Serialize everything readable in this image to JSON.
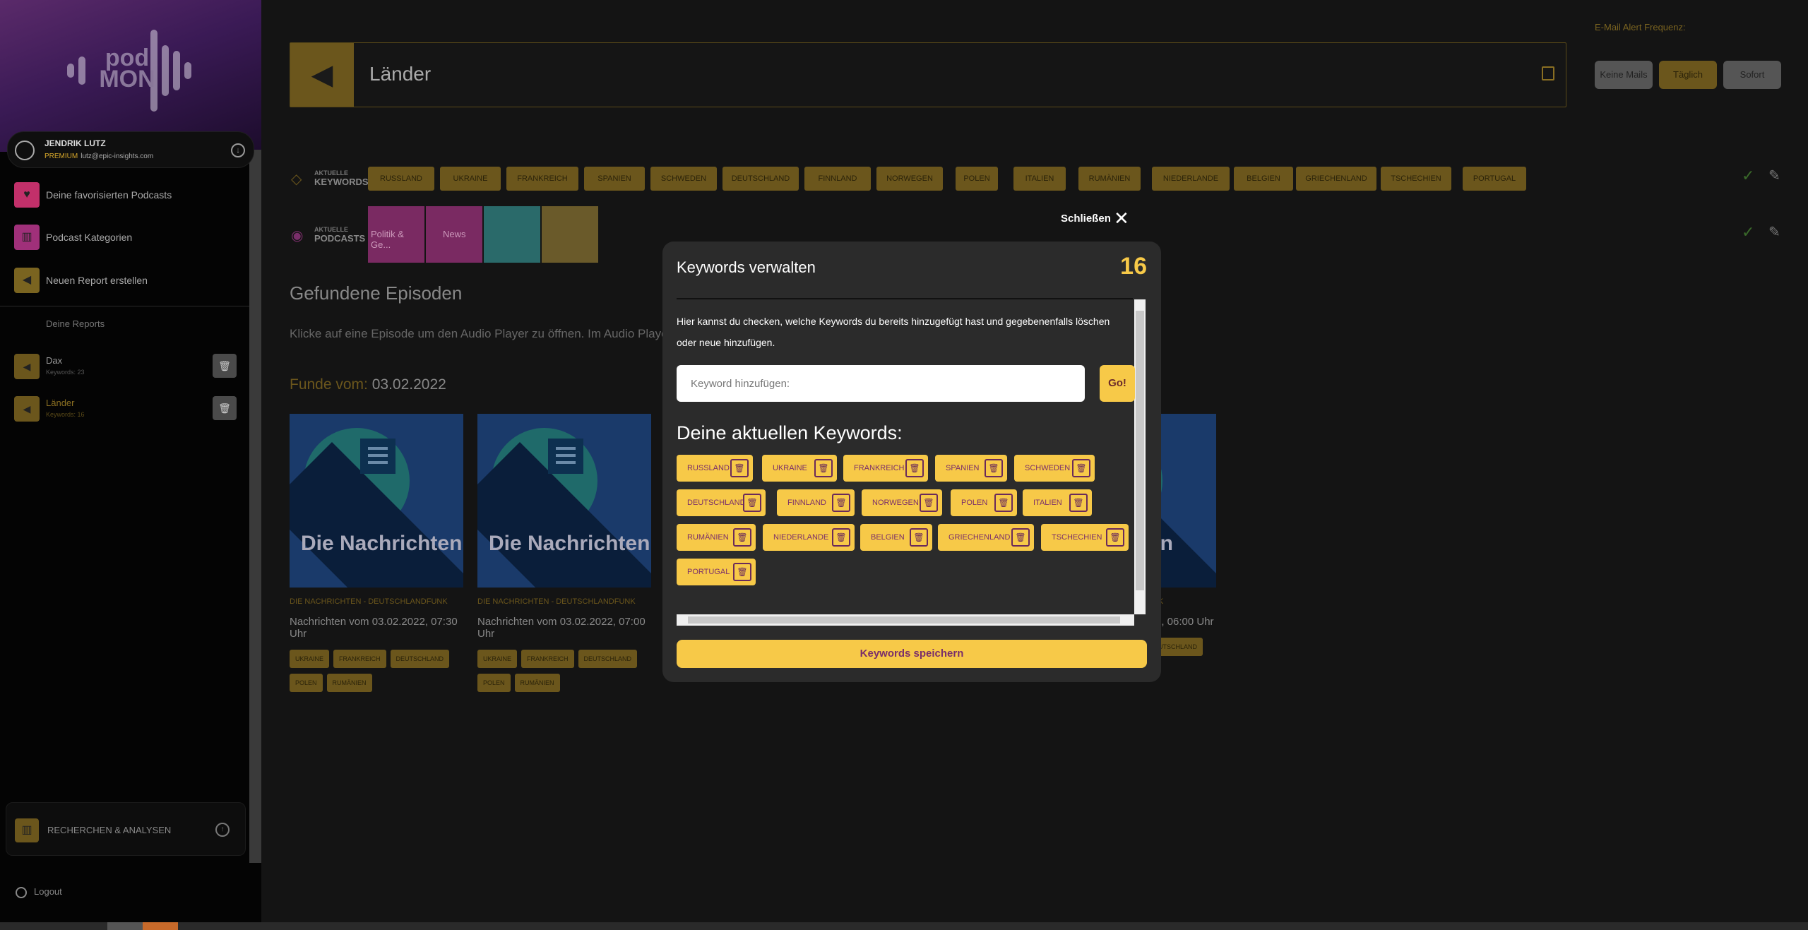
{
  "brand": {
    "logo_text_top": "pod",
    "logo_text_bottom": "MON"
  },
  "user": {
    "name": "JENDRIK LUTZ",
    "plan": "PREMIUM",
    "email": "lutz@epic-insights.com"
  },
  "sidebar": {
    "items": [
      {
        "label": "Deine favorisierten Podcasts",
        "icon": "heart-icon",
        "color": "#c2306a"
      },
      {
        "label": "Podcast Kategorien",
        "icon": "chart-icon",
        "color": "#a0307a"
      },
      {
        "label": "Neuen Report erstellen",
        "icon": "megaphone-icon",
        "color": "#7a6420"
      }
    ],
    "reports_title": "Deine Reports",
    "reports": [
      {
        "title": "Dax",
        "sub": "Keywords: 23"
      },
      {
        "title": "Länder",
        "sub": "Keywords: 16"
      }
    ],
    "research_label": "RECHERCHEN & ANALYSEN",
    "logout_label": "Logout"
  },
  "main": {
    "title": "Länder",
    "alert": {
      "label": "E-Mail Alert Frequenz:",
      "options": [
        "Keine Mails",
        "Täglich",
        "Sofort"
      ],
      "selected": "Täglich"
    },
    "keywords_label_small": "AKTUELLE",
    "keywords_label_big": "KEYWORDS",
    "podcasts_label_small": "AKTUELLE",
    "podcasts_label_big": "PODCASTS",
    "keywords": [
      "RUSSLAND",
      "UKRAINE",
      "FRANKREICH",
      "SPANIEN",
      "SCHWEDEN",
      "DEUTSCHLAND",
      "FINNLAND",
      "NORWEGEN",
      "POLEN",
      "ITALIEN",
      "RUMÄNIEN",
      "NIEDERLANDE",
      "BELGIEN",
      "GRIECHENLAND",
      "TSCHECHIEN",
      "PORTUGAL"
    ],
    "podcasts": [
      "Politik & Ge...",
      "News"
    ],
    "found_title": "Gefundene Episoden",
    "found_hint": "Klicke auf eine Episode um den Audio Player zu öffnen. Im Audio Player kannst du",
    "found_date_label": "Funde vom:",
    "found_date": "03.02.2022",
    "episodes": [
      {
        "image_text": "Die Nachrichten",
        "source": "DIE NACHRICHTEN - DEUTSCHLANDFUNK",
        "title": "Nachrichten vom 03.02.2022, 07:30 Uhr",
        "chips": [
          "UKRAINE",
          "FRANKREICH",
          "DEUTSCHLAND",
          "POLEN",
          "RUMÄNIEN"
        ]
      },
      {
        "image_text": "Die Nachrichten",
        "source": "DIE NACHRICHTEN - DEUTSCHLANDFUNK",
        "title": "Nachrichten vom 03.02.2022, 07:00 Uhr",
        "chips": [
          "UKRAINE",
          "FRANKREICH",
          "DEUTSCHLAND",
          "POLEN",
          "RUMÄNIEN"
        ]
      }
    ],
    "episode_partial": {
      "image_text": "en",
      "source": "UNK",
      "title": "2, 06:00 Uhr",
      "chip": "EUTSCHLAND"
    }
  },
  "modal": {
    "close_label": "Schließen",
    "title": "Keywords verwalten",
    "count": "16",
    "description": "Hier kannst du checken, welche Keywords du bereits hinzugefügt hast und gegebenenfalls löschen oder neue hinzufügen.",
    "input_placeholder": "Keyword hinzufügen:",
    "go_label": "Go!",
    "current_title": "Deine aktuellen Keywords:",
    "keywords": [
      "RUSSLAND",
      "UKRAINE",
      "FRANKREICH",
      "SPANIEN",
      "SCHWEDEN",
      "DEUTSCHLAND",
      "FINNLAND",
      "NORWEGEN",
      "POLEN",
      "ITALIEN",
      "RUMÄNIEN",
      "NIEDERLANDE",
      "BELGIEN",
      "GRIECHENLAND",
      "TSCHECHIEN",
      "PORTUGAL"
    ],
    "save_label": "Keywords speichern"
  },
  "colors": {
    "accent": "#f7c948",
    "accent_dim": "#6b561c",
    "chip_text": "#7a2e6a"
  }
}
